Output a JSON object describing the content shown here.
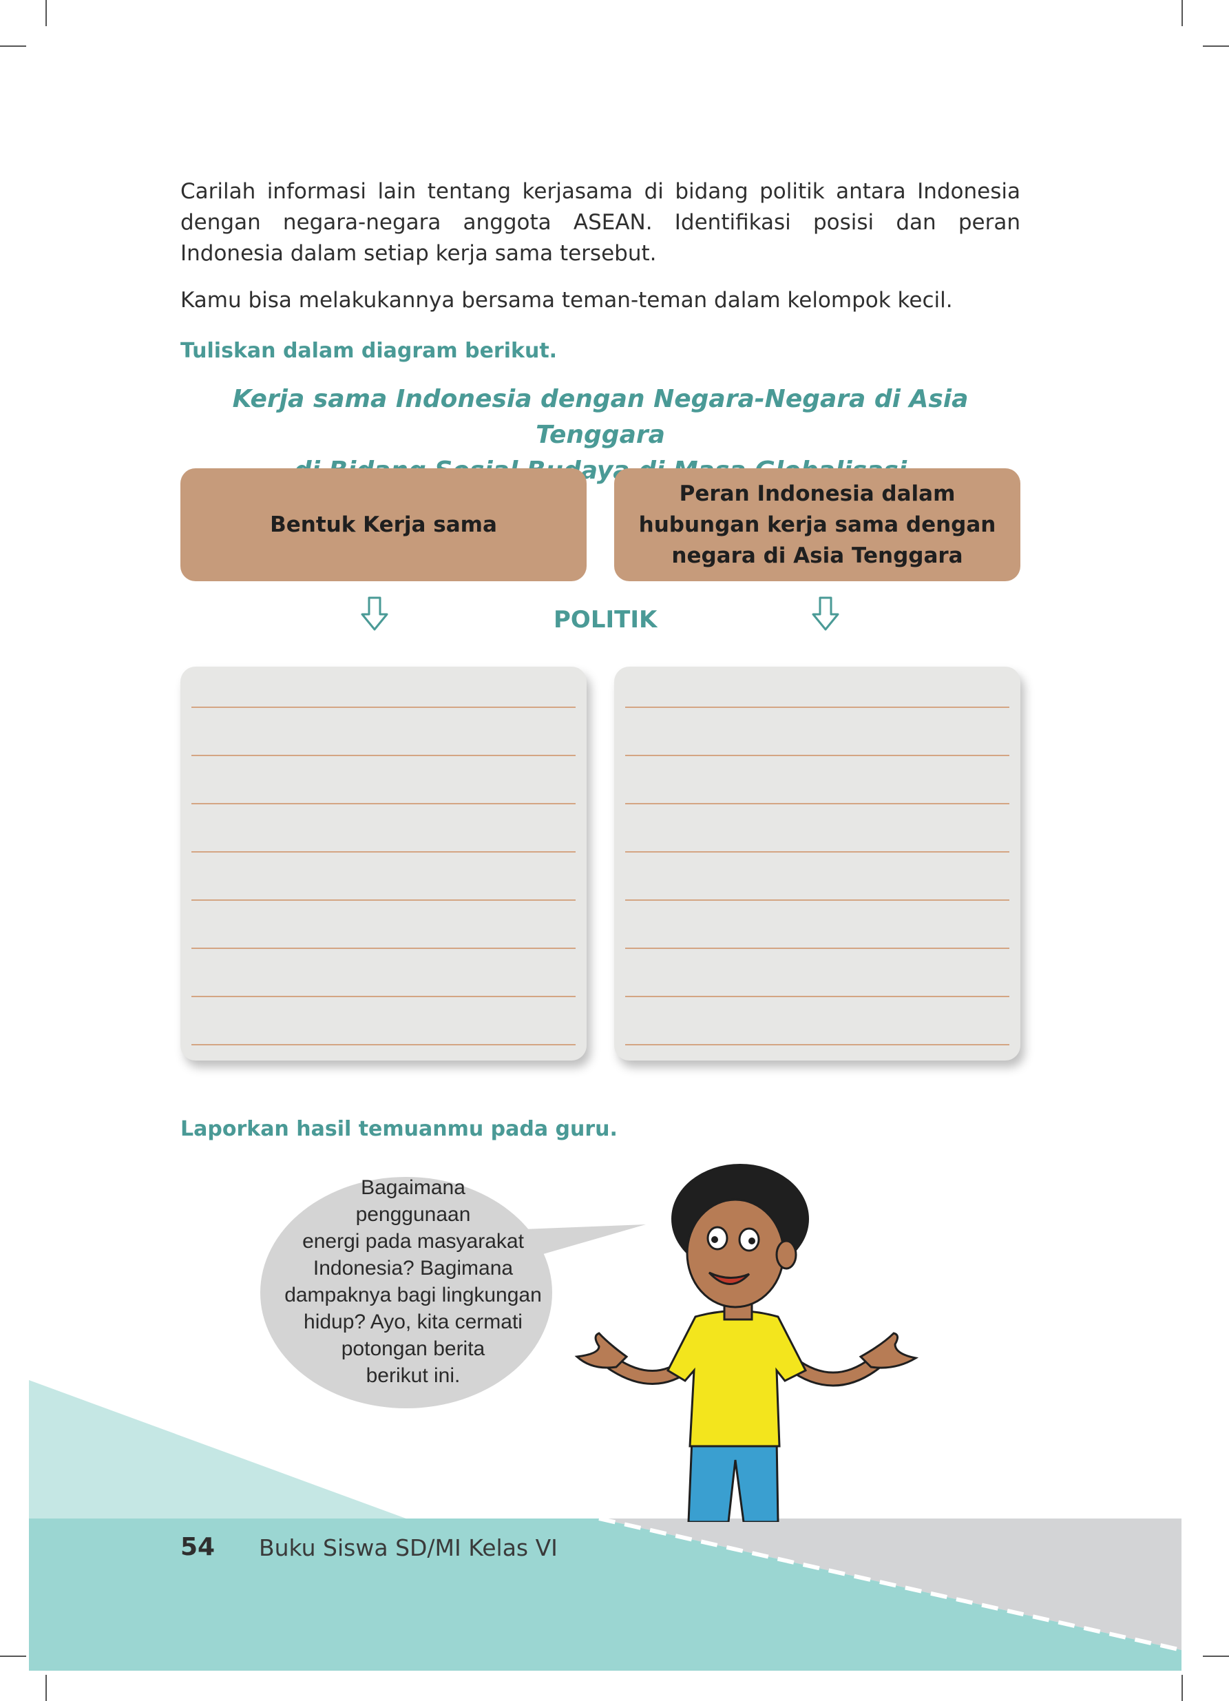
{
  "intro": {
    "paragraph1": "Carilah informasi lain tentang kerjasama di bidang politik antara Indonesia dengan negara-negara anggota ASEAN. Identifikasi posisi dan peran Indonesia dalam setiap kerja sama tersebut.",
    "paragraph2": "Kamu bisa melakukannya bersama teman-teman dalam kelompok kecil."
  },
  "instruction": "Tuliskan dalam diagram berikut.",
  "diagram": {
    "title_line1": "Kerja sama Indonesia dengan Negara-Negara di Asia Tenggara",
    "title_line2": "di Bidang Sosial Budaya di Masa Globalisasi",
    "left_header": "Bentuk Kerja sama",
    "right_header": "Peran Indonesia dalam hubungan kerja sama dengan negara di Asia Tenggara",
    "center_label": "POLITIK",
    "answer_lines_per_box": 8
  },
  "report_instruction": "Laporkan hasil temuanmu pada guru.",
  "speech_bubble": {
    "lines": [
      "Bagaimana",
      "penggunaan",
      "energi pada  masyarakat",
      "Indonesia? Bagimana",
      "dampaknya bagi lingkungan",
      "hidup? Ayo, kita  cermati",
      "potongan berita",
      "berikut ini."
    ]
  },
  "footer": {
    "page_number": "54",
    "book_title": "Buku Siswa SD/MI Kelas VI"
  },
  "colors": {
    "teal_text": "#4a9a96",
    "header_box": "#c69b7b",
    "answer_box": "#e7e7e5",
    "footer_teal": "#9bd6d2",
    "footer_light_teal": "#c5e7e4",
    "footer_gray": "#d3d4d6"
  }
}
